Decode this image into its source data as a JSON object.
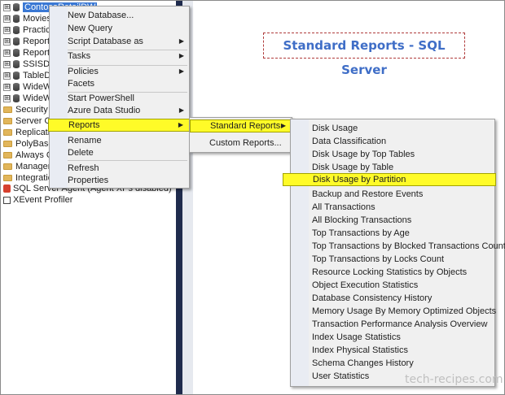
{
  "page_title": "Standard Reports - SQL Server",
  "watermark": "tech-recipes.com",
  "tree": {
    "selected": "ContosoRetailDW",
    "items": [
      {
        "label": "ContosoRetailDW",
        "expander": "⊞"
      },
      {
        "label": "Movies",
        "expander": "⊞"
      },
      {
        "label": "Practice",
        "expander": "⊞"
      },
      {
        "label": "ReportS",
        "expander": "⊞"
      },
      {
        "label": "ReportS",
        "expander": "⊞"
      },
      {
        "label": "SSISDB",
        "expander": "⊞"
      },
      {
        "label": "TableDi",
        "expander": "⊞"
      },
      {
        "label": "WideW",
        "expander": "⊞"
      },
      {
        "label": "WideW",
        "expander": "⊞"
      },
      {
        "label": "Security",
        "expander": ""
      },
      {
        "label": "Server Obj",
        "expander": ""
      },
      {
        "label": "Replication",
        "expander": ""
      },
      {
        "label": "PolyBase",
        "expander": ""
      },
      {
        "label": "Always On",
        "expander": ""
      },
      {
        "label": "Manageme",
        "expander": ""
      },
      {
        "label": "Integration",
        "expander": ""
      },
      {
        "label": "SQL Server Agent (Agent XPs disabled)",
        "expander": "⊞"
      },
      {
        "label": "XEvent Profiler",
        "expander": "⊞"
      }
    ]
  },
  "context_menu": {
    "items": [
      "New Database...",
      "New Query",
      "Script Database as",
      "Tasks",
      "Policies",
      "Facets",
      "Start PowerShell",
      "Azure Data Studio",
      "Reports",
      "Rename",
      "Delete",
      "Refresh",
      "Properties"
    ]
  },
  "reports_submenu": {
    "items": [
      "Standard Reports",
      "Custom Reports..."
    ]
  },
  "standard_reports_submenu": {
    "highlighted": "Disk Usage by Partition",
    "items": [
      "Disk Usage",
      "Data Classification",
      "Disk Usage by Top Tables",
      "Disk Usage by Table",
      "Disk Usage by Partition",
      "Backup and Restore Events",
      "All Transactions",
      "All Blocking Transactions",
      "Top Transactions by Age",
      "Top Transactions by Blocked Transactions Count",
      "Top Transactions by Locks Count",
      "Resource Locking Statistics by Objects",
      "Object Execution Statistics",
      "Database Consistency History",
      "Memory Usage By Memory Optimized Objects",
      "Transaction Performance Analysis Overview",
      "Index Usage Statistics",
      "Index Physical Statistics",
      "Schema Changes History",
      "User Statistics"
    ]
  },
  "colors": {
    "highlight": "#fffb28",
    "selection": "#3a78d4",
    "title": "#3f6ec7",
    "splitter": "#1f2b4d"
  }
}
